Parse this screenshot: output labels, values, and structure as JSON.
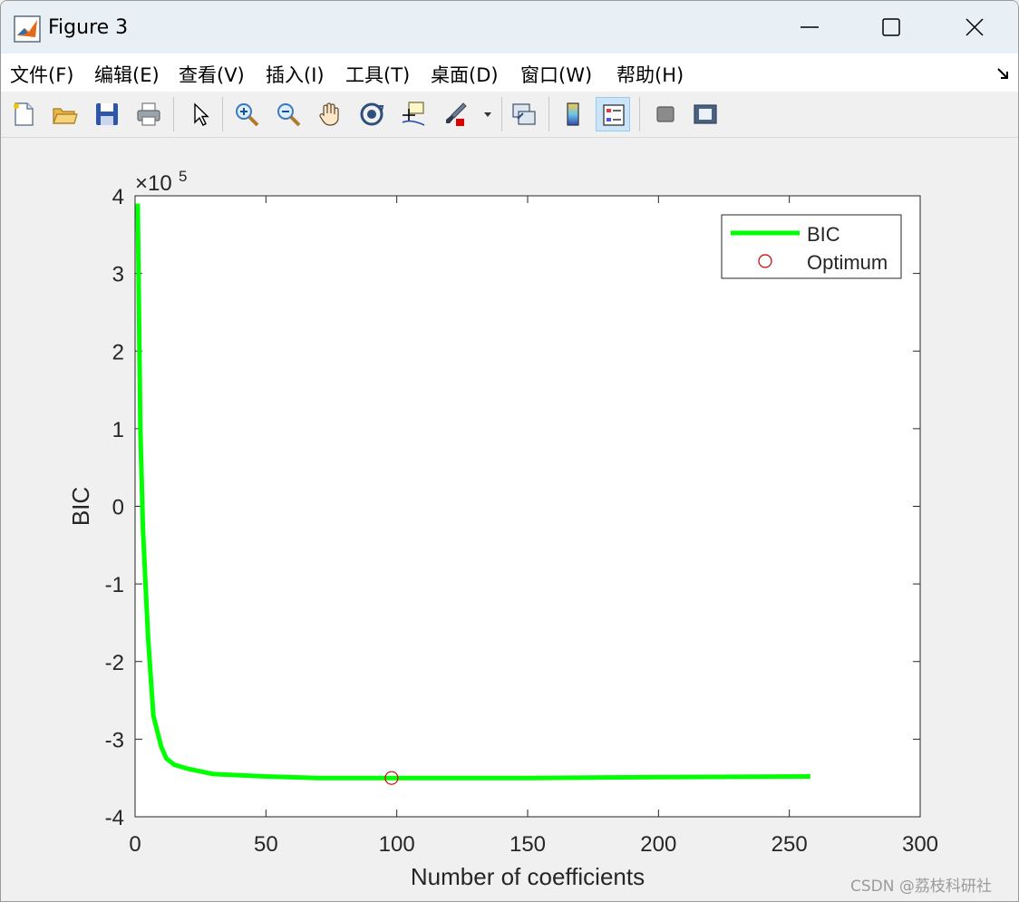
{
  "window": {
    "title": "Figure 3"
  },
  "menu": [
    "文件(F)",
    "编辑(E)",
    "查看(V)",
    "插入(I)",
    "工具(T)",
    "桌面(D)",
    "窗口(W)",
    "帮助(H)"
  ],
  "toolbar": {
    "icons": [
      "new-figure-icon",
      "open-file-icon",
      "save-icon",
      "print-icon",
      "edit-plot-arrow-icon",
      "zoom-in-icon",
      "zoom-out-icon",
      "pan-hand-icon",
      "rotate-3d-icon",
      "data-cursor-icon",
      "brush-icon",
      "brush-dropdown-icon",
      "link-plot-icon",
      "colorbar-icon",
      "legend-icon",
      "hide-plot-tools-icon",
      "show-plot-tools-icon"
    ]
  },
  "chart_data": {
    "type": "line",
    "xlabel": "Number of coefficients",
    "ylabel": "BIC",
    "y_exponent_label": "×10",
    "y_exponent_power": "5",
    "xlim": [
      0,
      300
    ],
    "ylim": [
      -4,
      4
    ],
    "xticks": [
      "0",
      "50",
      "100",
      "150",
      "200",
      "250",
      "300"
    ],
    "yticks": [
      "-4",
      "-3",
      "-2",
      "-1",
      "0",
      "1",
      "2",
      "3",
      "4"
    ],
    "xtick_values": [
      0,
      50,
      100,
      150,
      200,
      250,
      300
    ],
    "ytick_values": [
      -4,
      -3,
      -2,
      -1,
      0,
      1,
      2,
      3,
      4
    ],
    "legend_position": "top-right",
    "series": [
      {
        "name": "BIC",
        "color": "#00ff00",
        "x": [
          1,
          2,
          3,
          4,
          5,
          7,
          10,
          12,
          15,
          20,
          30,
          50,
          70,
          98,
          150,
          200,
          258
        ],
        "y": [
          3.9,
          1.0,
          -0.3,
          -1.0,
          -1.7,
          -2.7,
          -3.1,
          -3.25,
          -3.33,
          -3.38,
          -3.45,
          -3.48,
          -3.5,
          -3.5,
          -3.5,
          -3.49,
          -3.48
        ]
      },
      {
        "name": "Optimum",
        "color": "#cc0000",
        "marker": "circle",
        "x": [
          98
        ],
        "y": [
          -3.5
        ]
      }
    ]
  },
  "watermark": "CSDN @荔枝科研社"
}
